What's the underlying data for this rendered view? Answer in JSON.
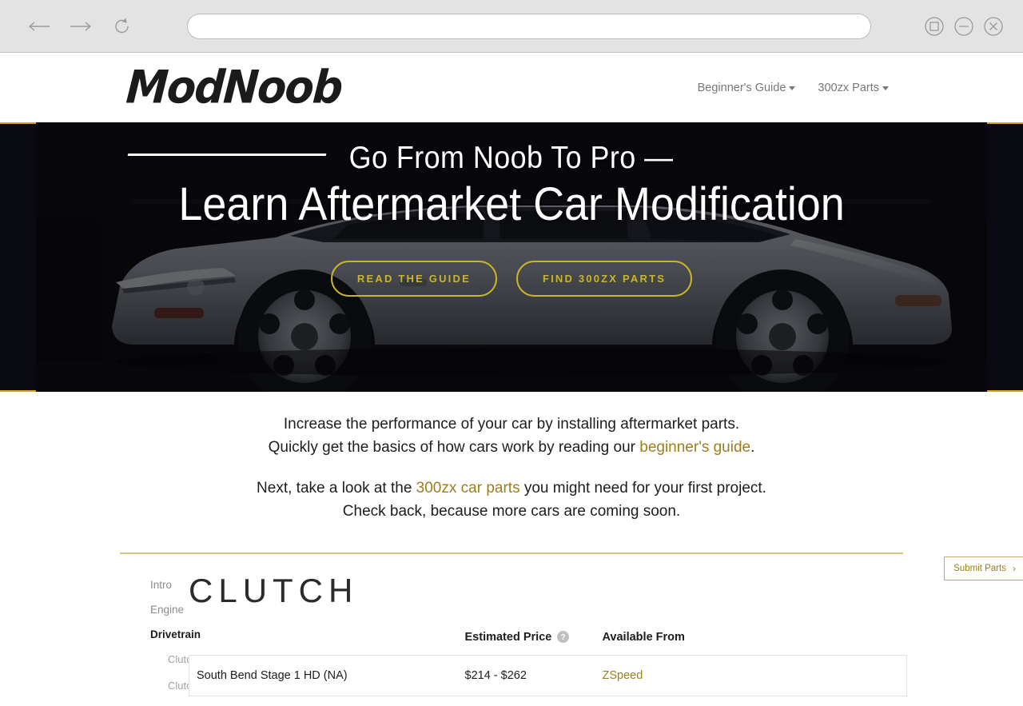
{
  "browser": {
    "back_icon": "back-arrow-icon",
    "forward_icon": "forward-arrow-icon",
    "reload_icon": "reload-icon",
    "url_value": "",
    "url_placeholder": "",
    "maximize_icon": "maximize-icon",
    "minimize_icon": "minimize-icon",
    "close_icon": "close-icon"
  },
  "header": {
    "logo": "ModNoob",
    "nav": [
      {
        "label": "Beginner's Guide"
      },
      {
        "label": "300zx Parts"
      }
    ]
  },
  "hero": {
    "eyebrow": "Go From Noob To Pro —",
    "title": "Learn Aftermarket Car Modification",
    "buttons": [
      {
        "label": "READ THE GUIDE"
      },
      {
        "label": "FIND 300ZX PARTS"
      }
    ]
  },
  "intro": {
    "line1": "Increase the performance of your car by installing aftermarket parts.",
    "line2_pre": "Quickly get the basics of how cars work by reading our ",
    "line2_link": "beginner's guide",
    "line2_post": ".",
    "line3_pre": "Next, take a look at the ",
    "line3_link": "300zx car parts",
    "line3_post": " you might need for your first project.",
    "line4": "Check back, because more cars are coming soon."
  },
  "sidebar": {
    "items": [
      {
        "label": "Intro",
        "level": "top",
        "active": false
      },
      {
        "label": "Engine",
        "level": "top",
        "active": false
      },
      {
        "label": "Drivetrain",
        "level": "top",
        "active": true
      },
      {
        "label": "Clutch",
        "level": "sub",
        "active": false
      },
      {
        "label": "Clutch Fork",
        "level": "sub",
        "active": false
      }
    ]
  },
  "main": {
    "section_title": "CLUTCH",
    "table": {
      "headers": {
        "name": "",
        "price": "Estimated Price",
        "vendor": "Available From"
      },
      "price_help_icon": "help-circle-icon",
      "rows": [
        {
          "name": "South Bend Stage 1 HD (NA)",
          "price": "$214 - $262",
          "vendor": "ZSpeed"
        }
      ]
    }
  },
  "submit_tab": {
    "label": "Submit Parts",
    "chevron": "›"
  },
  "colors": {
    "gold": "#c9b52b",
    "gold_link": "#9c7e1b",
    "gold_rule": "#d8c383",
    "hero_bg": "#0a0a12",
    "chrome_bg": "#e3e3e3"
  }
}
